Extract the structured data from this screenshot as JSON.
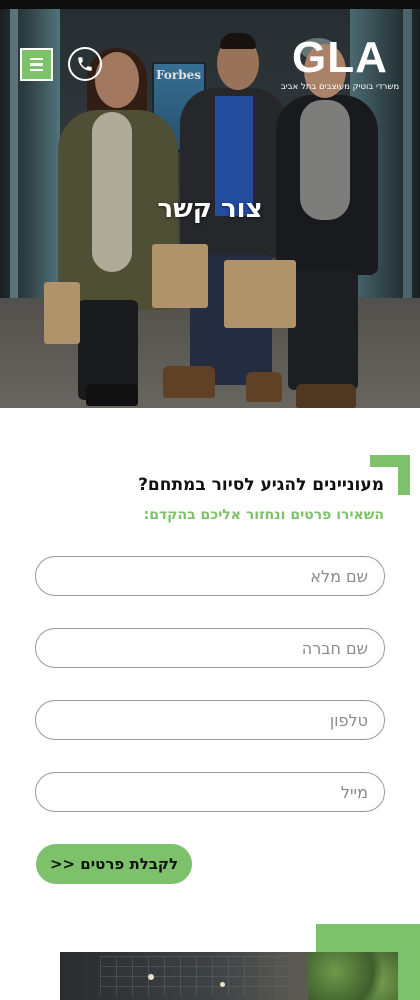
{
  "header": {
    "logo_text": "GLA",
    "logo_tagline": "משרדי בוטיק מעוצבים בתל אביב",
    "menu_icon": "hamburger-icon",
    "phone_icon": "phone-icon"
  },
  "hero": {
    "title": "צור קשר",
    "poster_text": "Forbes"
  },
  "form": {
    "heading": "מעוניינים להגיע לסיור במתחם?",
    "subheading": "השאירו פרטים ונחזור אליכם בהקדם:",
    "fields": [
      {
        "placeholder": "שם מלא",
        "value": ""
      },
      {
        "placeholder": "שם חברה",
        "value": ""
      },
      {
        "placeholder": "טלפון",
        "value": ""
      },
      {
        "placeholder": "מייל",
        "value": ""
      }
    ],
    "submit_label": "לקבלת פרטים <<"
  },
  "colors": {
    "accent": "#7dc26b",
    "text_dark": "#111111",
    "field_border": "#9a9a9a"
  }
}
